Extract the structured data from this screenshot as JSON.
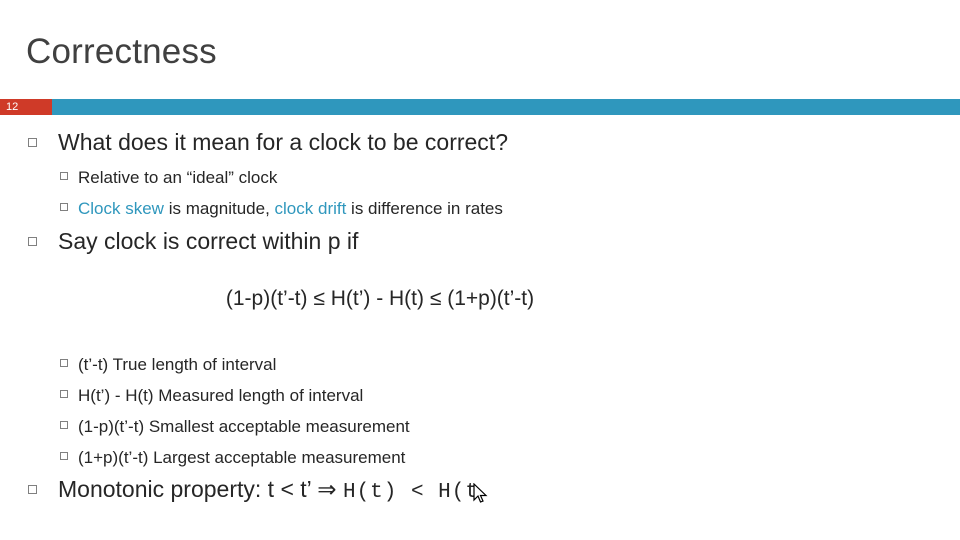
{
  "slide": {
    "title": "Correctness",
    "number": "12",
    "accent_color": "#2f97bd",
    "number_badge_color": "#cf3a28",
    "bullets": {
      "b1": "What does it mean for a clock to be correct?",
      "b1_sub1": "Relative to an “ideal” clock",
      "b1_sub2_part1": "Clock skew",
      "b1_sub2_part2": " is magnitude, ",
      "b1_sub2_part3": "clock drift",
      "b1_sub2_part4": " is difference in rates",
      "b2": "Say clock is correct within p if",
      "formula": "(1-p)(t’-t) ≤ H(t’) - H(t) ≤ (1+p)(t’-t)",
      "b2_sub1": "(t’-t)  True length of interval",
      "b2_sub2": "H(t’) - H(t)  Measured length of interval",
      "b2_sub3": "(1-p)(t’-t)  Smallest acceptable measurement",
      "b2_sub4": "(1+p)(t’-t)  Largest acceptable measurement",
      "b3_text": "Monotonic property:  t < t’  ⇒ ",
      "b3_mono": "H(t) < H(t"
    }
  }
}
